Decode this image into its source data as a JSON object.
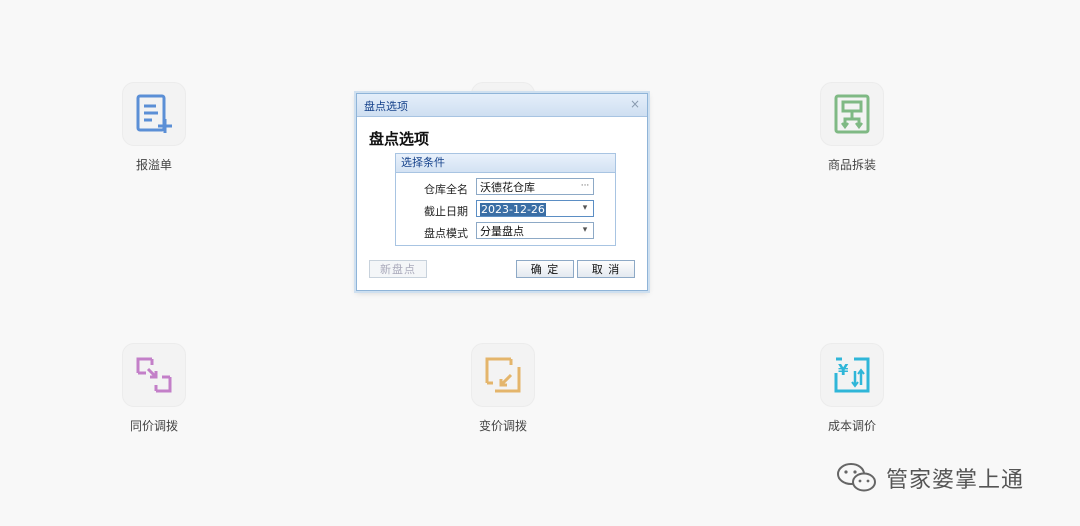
{
  "tiles": {
    "overflow_report": {
      "label": "报溢单",
      "color": "#5b8fd6"
    },
    "product_split": {
      "label": "商品拆装",
      "color": "#7fb984"
    },
    "same_price_transfer": {
      "label": "同价调拨",
      "color": "#c37fc8"
    },
    "price_change_transfer": {
      "label": "变价调拨",
      "color": "#e4b56b"
    },
    "cost_adjust": {
      "label": "成本调价",
      "color": "#2fb6d8"
    }
  },
  "dialog": {
    "window_title": "盘点选项",
    "close_symbol": "×",
    "heading": "盘点选项",
    "section_title": "选择条件",
    "fields": {
      "warehouse": {
        "label": "仓库全名",
        "value": "沃德花仓库",
        "trigger": "···"
      },
      "cutoff_date": {
        "label": "截止日期",
        "value": "2023-12-26",
        "trigger": "▾"
      },
      "count_mode": {
        "label": "盘点模式",
        "value": "分量盘点",
        "trigger": "▾"
      }
    },
    "buttons": {
      "new_count": "新盘点",
      "confirm": "确 定",
      "cancel": "取 消"
    }
  },
  "watermark": {
    "text": "管家婆掌上通"
  }
}
